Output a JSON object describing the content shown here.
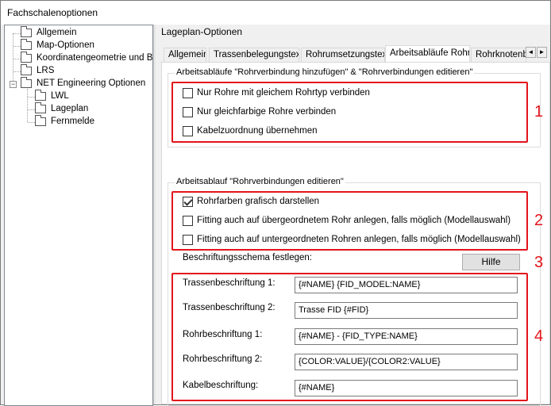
{
  "window": {
    "title": "Fachschalenoptionen"
  },
  "tree": {
    "items": [
      {
        "label": "Allgemein"
      },
      {
        "label": "Map-Optionen"
      },
      {
        "label": "Koordinatengeometrie und Berechnungen"
      },
      {
        "label": "LRS"
      },
      {
        "label": "NET Engineering Optionen"
      },
      {
        "label": "LWL"
      },
      {
        "label": "Lageplan"
      },
      {
        "label": "Fernmelde"
      }
    ],
    "expander": "−"
  },
  "panel": {
    "title": "Lageplan-Optionen",
    "tabs": [
      {
        "label": "Allgemein"
      },
      {
        "label": "Trassenbelegungstext"
      },
      {
        "label": "Rohrumsetzungstext"
      },
      {
        "label": "Arbeitsabläufe Rohr"
      },
      {
        "label": "Rohrknotenbeschriftung"
      }
    ],
    "scroll_left": "◄",
    "scroll_right": "►"
  },
  "group1": {
    "legend": "Arbeitsabläufe \"Rohrverbindung hinzufügen\" & \"Rohrverbindungen editieren\"",
    "checkboxes": [
      {
        "label": "Nur Rohre mit gleichem Rohrtyp verbinden",
        "checked": false
      },
      {
        "label": "Nur gleichfarbige Rohre verbinden",
        "checked": false
      },
      {
        "label": "Kabelzuordnung übernehmen",
        "checked": false
      }
    ]
  },
  "group2": {
    "legend": "Arbeitsablauf \"Rohrverbindungen editieren\"",
    "checkboxes": [
      {
        "label": "Rohrfarben grafisch darstellen",
        "checked": true
      },
      {
        "label": "Fitting auch auf übergeordnetem Rohr anlegen, falls möglich (Modellauswahl)",
        "checked": false
      },
      {
        "label": "Fitting auch auf untergeordneten Rohren anlegen, falls möglich (Modellauswahl)",
        "checked": false
      }
    ],
    "schema_label": "Beschriftungsschema festlegen:",
    "help_button": "Hilfe",
    "fields": [
      {
        "label": "Trassenbeschriftung 1:",
        "value": "{#NAME} {FID_MODEL:NAME}"
      },
      {
        "label": "Trassenbeschriftung 2:",
        "value": "Trasse FID {#FID}"
      },
      {
        "label": "Rohrbeschriftung 1:",
        "value": "{#NAME} - {FID_TYPE:NAME}"
      },
      {
        "label": "Rohrbeschriftung 2:",
        "value": "{COLOR:VALUE}/{COLOR2:VALUE}"
      },
      {
        "label": "Kabelbeschriftung:",
        "value": "{#NAME}"
      }
    ]
  },
  "annotations": {
    "n1": "1",
    "n2": "2",
    "n3": "3",
    "n4": "4",
    "color": "#e3141b"
  }
}
